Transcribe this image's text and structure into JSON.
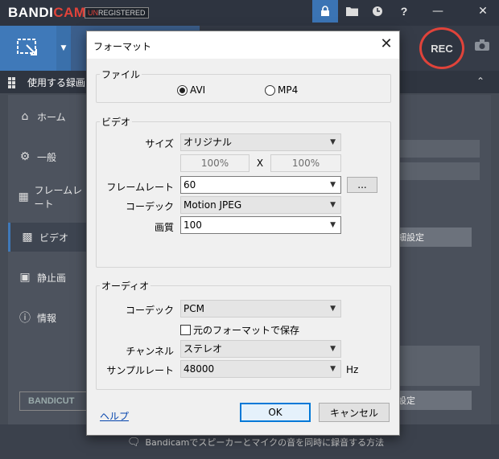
{
  "app": {
    "brand_prefix": "BANDI",
    "brand_suffix": "CAM",
    "unreg_prefix": "UN",
    "unreg_suffix": "REGISTERED",
    "section_title": "使用する録画モ",
    "nav": [
      {
        "label": "ホーム",
        "icon": "home-icon"
      },
      {
        "label": "一般",
        "icon": "gear-icon"
      },
      {
        "label": "フレームレート",
        "icon": "framerate-icon"
      },
      {
        "label": "ビデオ",
        "icon": "video-settings-icon"
      },
      {
        "label": "静止画",
        "icon": "image-icon"
      },
      {
        "label": "情報",
        "icon": "info-icon"
      }
    ],
    "rec_label": "REC",
    "bandicut_label": "BANDICUT",
    "bg_detail_button": "細設定",
    "bg_setting_button": "設定",
    "footer_tip": "Bandicamでスピーカーとマイクの音を同時に録音する方法",
    "accent_color": "#3f79b9",
    "rec_color": "#e0433a"
  },
  "dialog": {
    "title": "フォーマット",
    "file_group": "ファイル",
    "file_options": [
      "AVI",
      "MP4"
    ],
    "file_selected": "AVI",
    "video_group": "ビデオ",
    "size_label": "サイズ",
    "size_value": "オリジナル",
    "width_value": "100%",
    "x_sep": "X",
    "height_value": "100%",
    "framerate_label": "フレームレート",
    "framerate_value": "60",
    "more_button": "...",
    "codec_label": "コーデック",
    "codec_value": "Motion JPEG",
    "quality_label": "画質",
    "quality_value": "100",
    "audio_group": "オーディオ",
    "audio_codec_label": "コーデック",
    "audio_codec_value": "PCM",
    "keep_format_label": "元のフォーマットで保存",
    "channel_label": "チャンネル",
    "channel_value": "ステレオ",
    "samplerate_label": "サンプルレート",
    "samplerate_value": "48000",
    "samplerate_unit": "Hz",
    "help_link": "ヘルプ",
    "ok_button": "OK",
    "cancel_button": "キャンセル"
  }
}
